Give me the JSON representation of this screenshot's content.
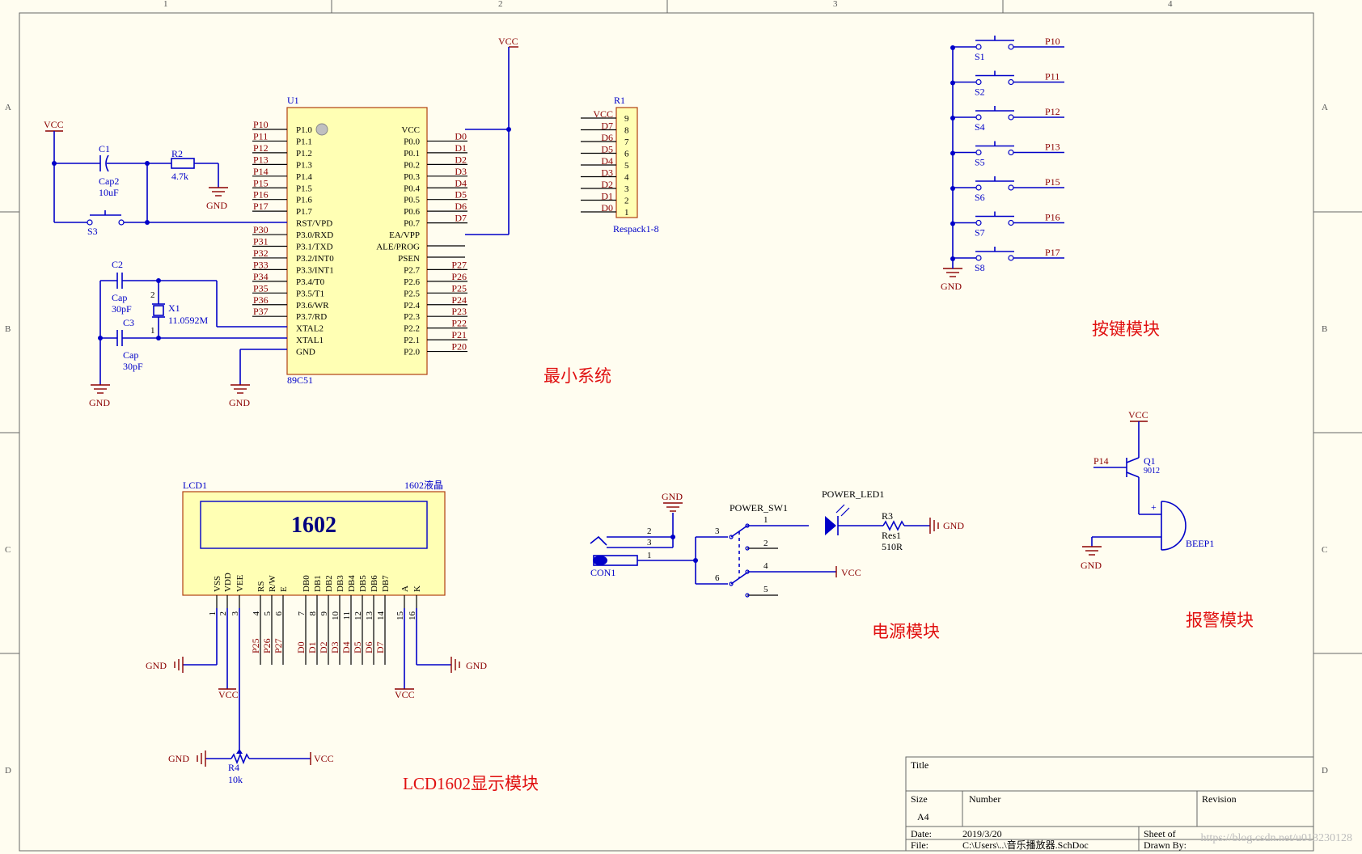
{
  "grid": {
    "cols": [
      "1",
      "2",
      "3",
      "4"
    ],
    "rows": [
      "A",
      "B",
      "C",
      "D"
    ]
  },
  "modules": {
    "min_system": "最小系统",
    "keys": "按键模块",
    "alarm": "报警模块",
    "power": "电源模块",
    "lcd": "LCD1602显示模块"
  },
  "net": {
    "vcc": "VCC",
    "gnd": "GND"
  },
  "mcu": {
    "ref": "U1",
    "part": "89C51",
    "left_pins": [
      "P1.0",
      "P1.1",
      "P1.2",
      "P1.3",
      "P1.4",
      "P1.5",
      "P1.6",
      "P1.7",
      "RST/VPD",
      "P3.0/RXD",
      "P3.1/TXD",
      "P3.2/INT0",
      "P3.3/INT1",
      "P3.4/T0",
      "P3.5/T1",
      "P3.6/WR",
      "P3.7/RD",
      "XTAL2",
      "XTAL1",
      "GND"
    ],
    "right_pins": [
      "VCC",
      "P0.0",
      "P0.1",
      "P0.2",
      "P0.3",
      "P0.4",
      "P0.5",
      "P0.6",
      "P0.7",
      "EA/VPP",
      "ALE/PROG",
      "PSEN",
      "P2.7",
      "P2.6",
      "P2.5",
      "P2.4",
      "P2.3",
      "P2.2",
      "P2.1",
      "P2.0"
    ],
    "left_nets": [
      "P10",
      "P11",
      "P12",
      "P13",
      "P14",
      "P15",
      "P16",
      "P17",
      "",
      "P30",
      "P31",
      "P32",
      "P33",
      "P34",
      "P35",
      "P36",
      "P37"
    ],
    "right_nets": [
      "",
      "D0",
      "D1",
      "D2",
      "D3",
      "D4",
      "D5",
      "D6",
      "D7",
      "",
      "",
      "",
      "P27",
      "P26",
      "P25",
      "P24",
      "P23",
      "P22",
      "P21",
      "P20"
    ]
  },
  "reset": {
    "c1_ref": "C1",
    "c1_part": "Cap2",
    "c1_val": "10uF",
    "r2_ref": "R2",
    "r2_val": "4.7k",
    "s3_ref": "S3"
  },
  "crystal": {
    "c2_ref": "C2",
    "c3_ref": "C3",
    "cap": "Cap",
    "cap_val": "30pF",
    "x1_ref": "X1",
    "x1_val": "11.0592M",
    "pin1": "1",
    "pin2": "2"
  },
  "respack": {
    "ref": "R1",
    "part": "Respack1-8",
    "nets": [
      "VCC",
      "D7",
      "D6",
      "D5",
      "D4",
      "D3",
      "D2",
      "D1",
      "D0"
    ],
    "pins": [
      "9",
      "8",
      "7",
      "6",
      "5",
      "4",
      "3",
      "2",
      "1"
    ]
  },
  "keys": {
    "switches": [
      {
        "ref": "S1",
        "net": "P10"
      },
      {
        "ref": "S2",
        "net": "P11"
      },
      {
        "ref": "S4",
        "net": "P12"
      },
      {
        "ref": "S5",
        "net": "P13"
      },
      {
        "ref": "S6",
        "net": "P15"
      },
      {
        "ref": "S7",
        "net": "P16"
      },
      {
        "ref": "S8",
        "net": "P17"
      }
    ]
  },
  "alarm": {
    "q_ref": "Q1",
    "q_part": "9012",
    "q_net": "P14",
    "buzzer": "BEEP1",
    "plus": "+"
  },
  "power": {
    "con_ref": "CON1",
    "con_pins": [
      "2",
      "3",
      "1"
    ],
    "sw_ref": "POWER_SW1",
    "sw_pins": [
      "3",
      "1",
      "2",
      "6",
      "4",
      "5"
    ],
    "led_ref": "POWER_LED1",
    "r_ref": "R3",
    "r_part": "Res1",
    "r_val": "510R"
  },
  "lcd": {
    "ref": "LCD1",
    "part": "1602液晶",
    "label": "1602",
    "pins": [
      "VSS",
      "VDD",
      "VEE",
      "RS",
      "R/W",
      "E",
      "DB0",
      "DB1",
      "DB2",
      "DB3",
      "DB4",
      "DB5",
      "DB6",
      "DB7",
      "A",
      "K"
    ],
    "pin_numbers": [
      "1",
      "2",
      "3",
      "4",
      "5",
      "6",
      "7",
      "8",
      "9",
      "10",
      "11",
      "12",
      "13",
      "14",
      "15",
      "16"
    ],
    "nets": [
      "P25",
      "P26",
      "P27",
      "D0",
      "D1",
      "D2",
      "D3",
      "D4",
      "D5",
      "D6",
      "D7"
    ],
    "pot_ref": "R4",
    "pot_val": "10k"
  },
  "title_block": {
    "title": "Title",
    "size": "Size",
    "size_val": "A4",
    "number": "Number",
    "revision": "Revision",
    "date": "Date:",
    "date_val": "2019/3/20",
    "sheet": "Sheet   of",
    "file": "File:",
    "file_val": "C:\\Users\\..\\音乐播放器.SchDoc",
    "drawn": "Drawn By:",
    "watermark": "https://blog.csdn.net/u013230128"
  }
}
